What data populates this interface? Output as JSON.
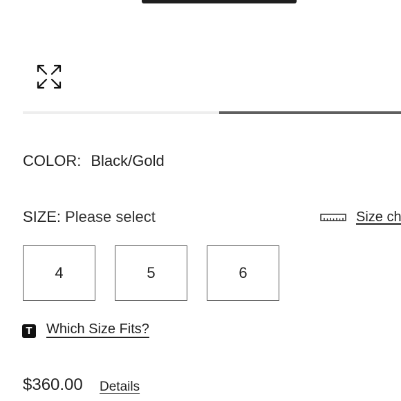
{
  "product": {
    "color_label": "COLOR:",
    "color_value": "Black/Gold",
    "size_label": "SIZE:",
    "size_placeholder": "Please select",
    "size_chart_label": "Size chart",
    "sizes": [
      "4",
      "5",
      "6"
    ],
    "fit_badge": "T",
    "fit_link": "Which Size Fits?",
    "price": "$360.00",
    "details_link": "Details"
  },
  "icons": {
    "expand": "expand-arrows-icon",
    "ruler": "ruler-icon"
  }
}
